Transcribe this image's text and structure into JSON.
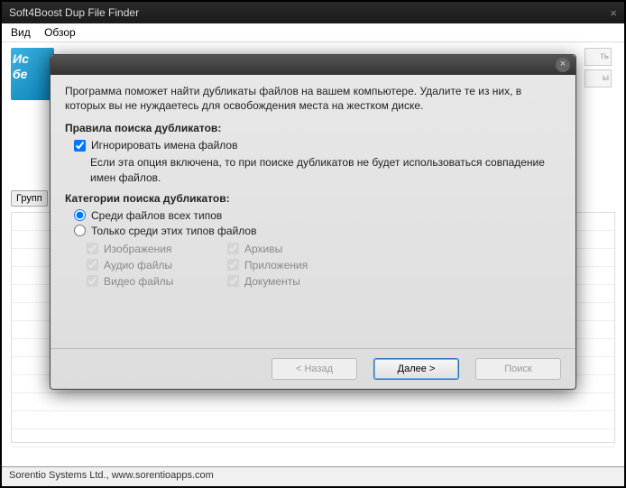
{
  "window": {
    "title": "Soft4Boost Dup File Finder",
    "close_glyph": "×"
  },
  "menu": {
    "view": "Вид",
    "browse": "Обзор"
  },
  "banner": {
    "l1": "Ис",
    "l2": "бе"
  },
  "side": {
    "b1": "ть",
    "b2": "ы"
  },
  "group": {
    "label": "Групп"
  },
  "status": "Sorentio Systems Ltd., www.sorentioapps.com",
  "modal": {
    "close_glyph": "×",
    "intro": "Программа поможет найти дубликаты файлов на вашем компьютере. Удалите те из них, в которых вы не нуждаетесь для освобождения места на жестком диске.",
    "rules_head": "Правила поиска дубликатов:",
    "ignore_names": "Игнорировать имена файлов",
    "ignore_hint": "Если эта опция включена, то при поиске дубликатов не будет использоваться совпадение имен файлов.",
    "cats_head": "Категории поиска дубликатов:",
    "radio_all": "Среди файлов всех типов",
    "radio_only": "Только среди этих типов файлов",
    "ft": {
      "images": "Изображения",
      "arch": "Архивы",
      "audio": "Аудио файлы",
      "apps": "Приложения",
      "video": "Видео файлы",
      "docs": "Документы"
    },
    "btn_back": "< Назад",
    "btn_next": "Далее >",
    "btn_search": "Поиск"
  }
}
